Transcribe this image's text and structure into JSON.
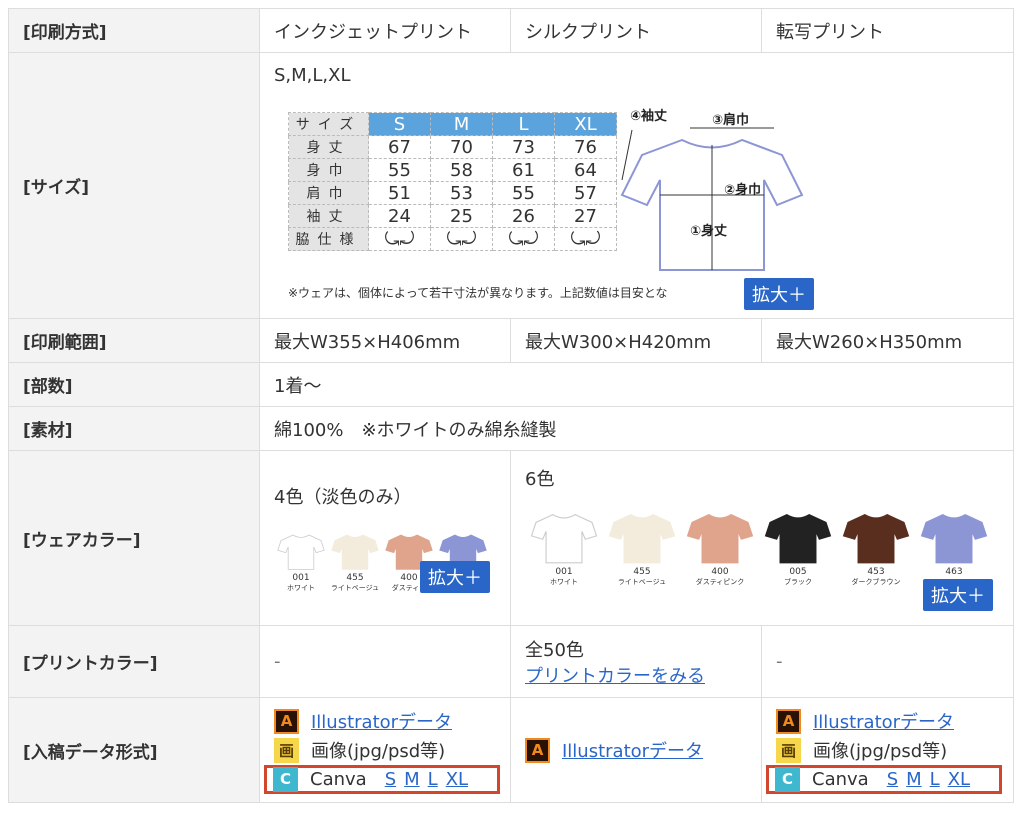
{
  "labels": {
    "method": "[印刷方式]",
    "size": "[サイズ]",
    "range": "[印刷範囲]",
    "qty": "[部数]",
    "material": "[素材]",
    "wear_color": "[ウェアカラー]",
    "print_color": "[プリントカラー]",
    "format": "[入稿データ形式]"
  },
  "methods": [
    "インクジェットプリント",
    "シルクプリント",
    "転写プリント"
  ],
  "size": {
    "list": "S,M,L,XL",
    "header": [
      "サイズ",
      "S",
      "M",
      "L",
      "XL"
    ],
    "rows": [
      {
        "label": "身丈",
        "values": [
          "67",
          "70",
          "73",
          "76"
        ]
      },
      {
        "label": "身巾",
        "values": [
          "55",
          "58",
          "61",
          "64"
        ]
      },
      {
        "label": "肩巾",
        "values": [
          "51",
          "53",
          "55",
          "57"
        ]
      },
      {
        "label": "袖丈",
        "values": [
          "24",
          "25",
          "26",
          "27"
        ]
      },
      {
        "label": "脇仕様",
        "values": [
          "",
          "",
          "",
          ""
        ]
      }
    ],
    "note": "※ウェアは、個体によって若干寸法が異なります。上記数値は目安とな",
    "diagram_labels": [
      "④袖丈",
      "③肩巾",
      "②身巾",
      "①身丈"
    ]
  },
  "zoom_label": "拡大＋",
  "ranges": [
    "最大W355×H406mm",
    "最大W300×H420mm",
    "最大W260×H350mm"
  ],
  "qty": "1着〜",
  "material": "綿100%　※ホワイトのみ綿糸縫製",
  "wear_colors": {
    "inkjet_title": "4色（淡色のみ）",
    "silk_title": "6色",
    "inkjet": [
      {
        "code": "001",
        "name": "ホワイト",
        "color": "#ffffff"
      },
      {
        "code": "455",
        "name": "ライトベージュ",
        "color": "#f3ecdc"
      },
      {
        "code": "400",
        "name": "ダスティピ",
        "color": "#e0a48c"
      },
      {
        "code": "",
        "name": "",
        "color": "#8d96d4"
      }
    ],
    "silk": [
      {
        "code": "001",
        "name": "ホワイト",
        "color": "#ffffff"
      },
      {
        "code": "455",
        "name": "ライトベージュ",
        "color": "#f3ecdc"
      },
      {
        "code": "400",
        "name": "ダスティピンク",
        "color": "#e0a48c"
      },
      {
        "code": "005",
        "name": "ブラック",
        "color": "#222222"
      },
      {
        "code": "453",
        "name": "ダークブラウン",
        "color": "#5a2e1e"
      },
      {
        "code": "463",
        "name": "",
        "color": "#8d96d4"
      }
    ]
  },
  "print_colors": {
    "inkjet": "-",
    "silk_count": "全50色",
    "silk_link": "プリントカラーをみる",
    "transfer": "-"
  },
  "formats": {
    "ai_icon": "A",
    "img_icon": "画",
    "canva_icon": "C",
    "ai_label": "Illustratorデータ",
    "img_label": "画像(jpg/psd等)",
    "canva_label": "Canva",
    "canva_sizes": [
      "S",
      "M",
      "L",
      "XL"
    ]
  },
  "colors": {
    "accent": "#2a66c8",
    "header_bg": "#f3f3f3",
    "highlight": "#d2462c",
    "size_header": "#5ba3dc"
  }
}
